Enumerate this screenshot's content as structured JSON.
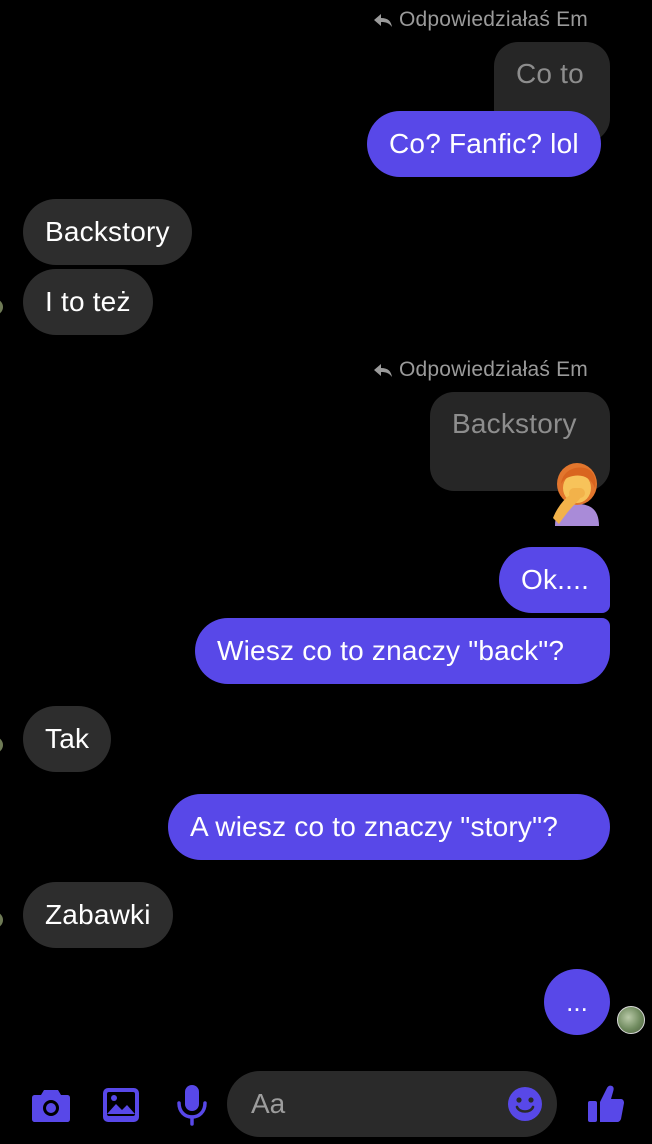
{
  "colors": {
    "background": "#000000",
    "outgoing_bubble": "#5848e8",
    "incoming_bubble": "#2d2d2d",
    "accent_icons": "#5848e8",
    "reply_label": "#9a9a9a"
  },
  "conversation": {
    "reply_1": {
      "label": "Odpowiedziałaś Em",
      "icon": "reply-arrow-icon"
    },
    "quoted_1": "Co to",
    "msg_out_1": "Co? Fanfic? lol",
    "msg_in_1": "Backstory",
    "msg_in_2": "I to też",
    "reply_2": {
      "label": "Odpowiedziałaś Em",
      "icon": "reply-arrow-icon"
    },
    "quoted_2": "Backstory",
    "reaction": "woman-facepalming-emoji",
    "msg_out_2": "Ok....",
    "msg_out_3": "Wiesz co to znaczy \"back\"?",
    "msg_in_3": "Tak",
    "msg_out_4": "A wiesz co to znaczy \"story\"?",
    "msg_in_4": "Zabawki",
    "msg_out_5": "..."
  },
  "composer": {
    "placeholder": "Aa",
    "icons": [
      "camera-icon",
      "gallery-icon",
      "microphone-icon",
      "emoji-icon",
      "thumbs-up-icon"
    ]
  }
}
